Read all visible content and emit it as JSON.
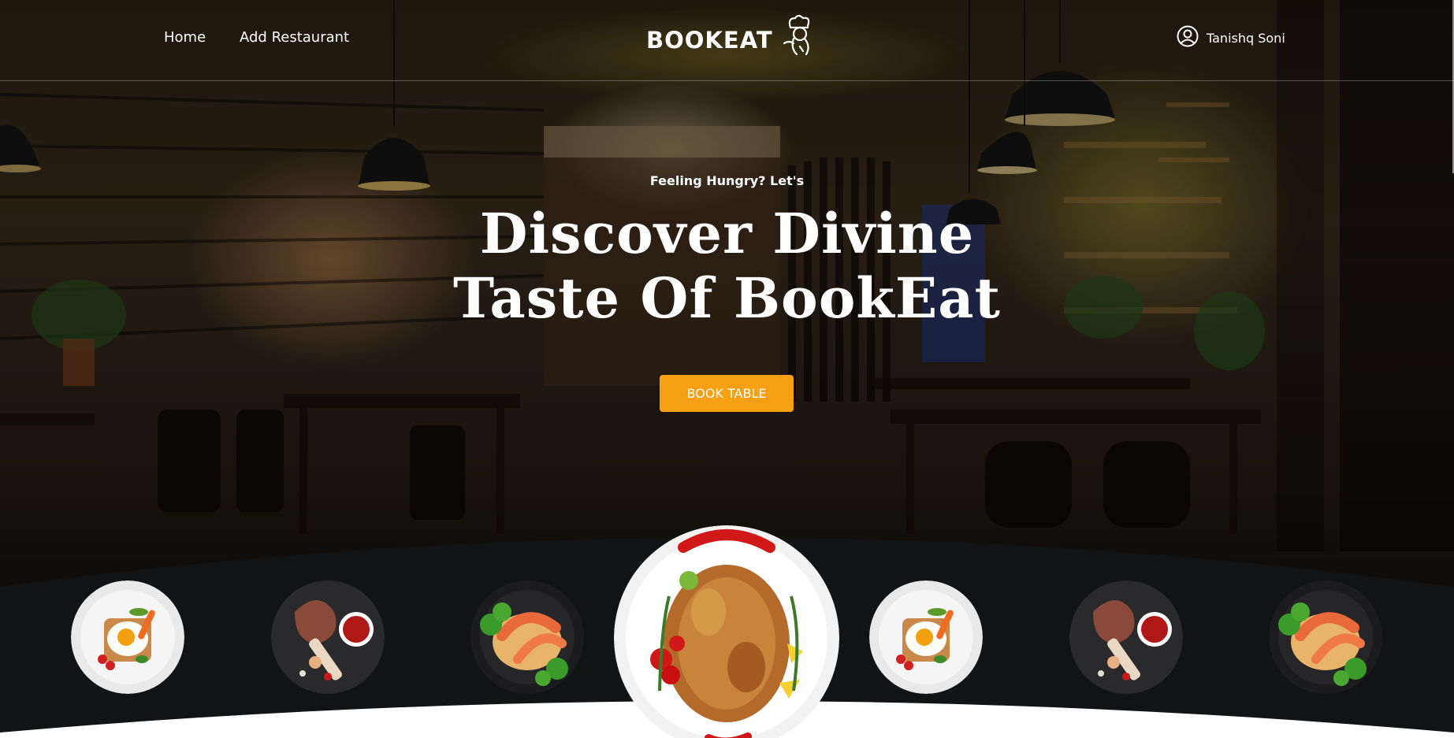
{
  "nav": {
    "home_label": "Home",
    "add_restaurant_label": "Add Restaurant",
    "logo_text": "BOOKEAT",
    "user_name": "Tanishq Soni"
  },
  "hero": {
    "eyebrow": "Feeling Hungry? Let's",
    "headline_line1": "Discover Divine",
    "headline_line2": "Taste Of BookEat",
    "cta_label": "BOOK TABLE"
  },
  "dishes": [
    {
      "name": "egg-toast-plate"
    },
    {
      "name": "tomahawk-steak-plate"
    },
    {
      "name": "shrimp-noodle-plate"
    },
    {
      "name": "roast-chicken-plate"
    },
    {
      "name": "egg-toast-plate"
    },
    {
      "name": "tomahawk-steak-plate"
    },
    {
      "name": "shrimp-noodle-plate"
    }
  ],
  "colors": {
    "accent": "#f7a014",
    "strip": "#111315",
    "text": "#ffffff"
  }
}
